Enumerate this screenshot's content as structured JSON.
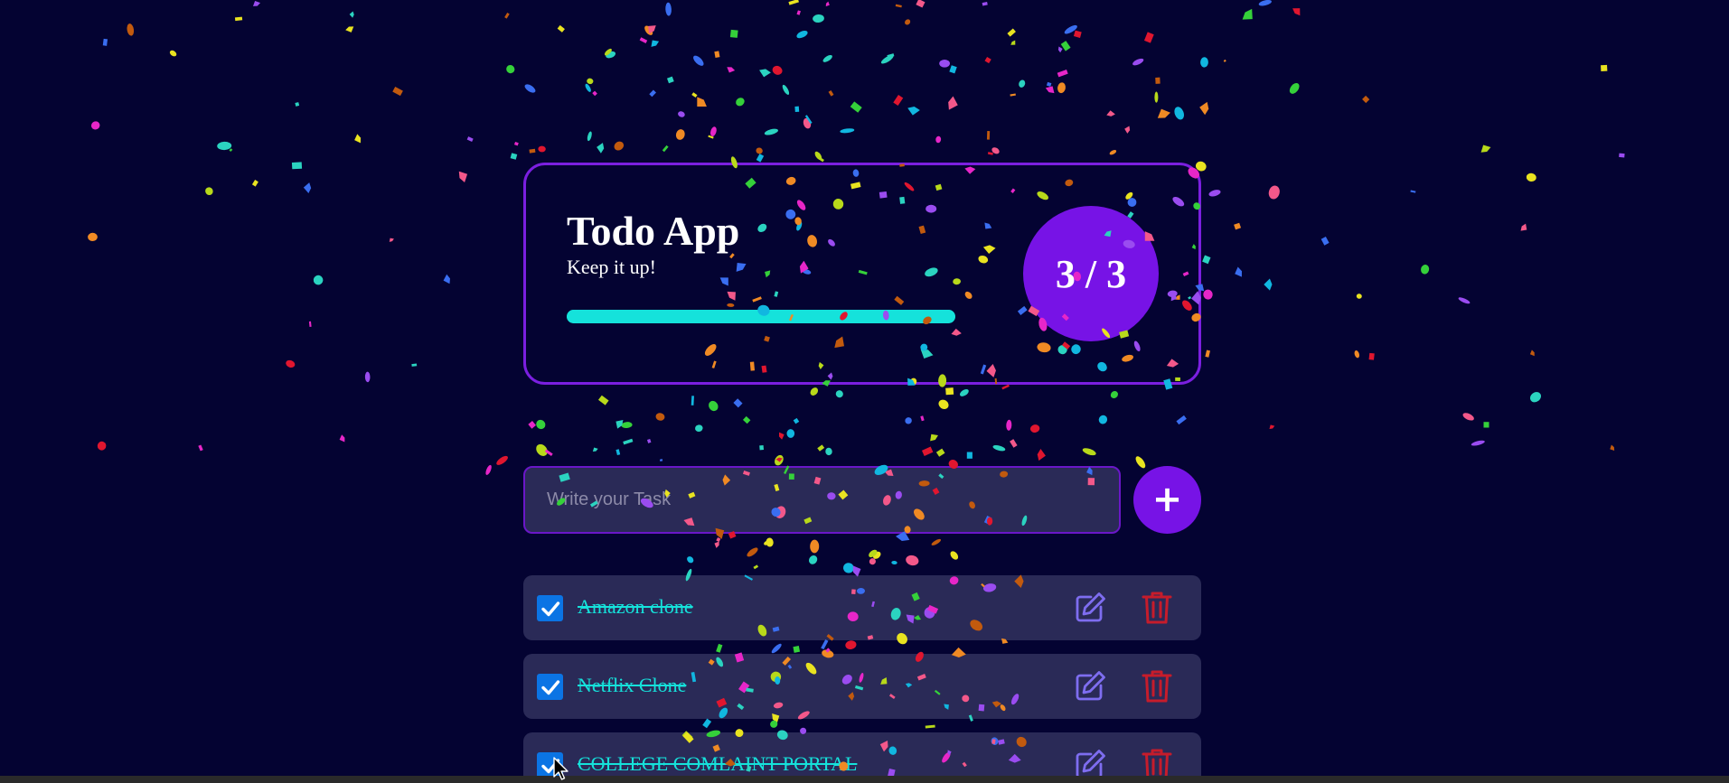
{
  "header": {
    "title": "Todo App",
    "subtitle": "Keep it up!",
    "progress_fraction": 1.0,
    "completed_count": 3,
    "total_count": 3,
    "badge_text": "3 / 3"
  },
  "form": {
    "placeholder": "Write your Task",
    "input_value": "",
    "add_button_label": "+"
  },
  "tasks": [
    {
      "text": "Amazon clone",
      "completed": true
    },
    {
      "text": "Netflix Clone",
      "completed": true
    },
    {
      "text": "COLLEGE COMLAINT PORTAL",
      "completed": true
    }
  ],
  "icons": {
    "checkbox": "checkmark-icon",
    "edit": "edit-pencil-icon",
    "delete": "trash-icon",
    "add": "plus-icon"
  },
  "colors": {
    "background": "#040332",
    "accent_purple": "#7713e6",
    "card_border": "#7b1fe0",
    "progress": "#15e2db",
    "task_bg": "#2a2a57",
    "task_text": "#15e2db",
    "checkbox": "#0b74e4",
    "edit_icon": "#7e6df0",
    "delete_icon": "#c61c2b"
  }
}
